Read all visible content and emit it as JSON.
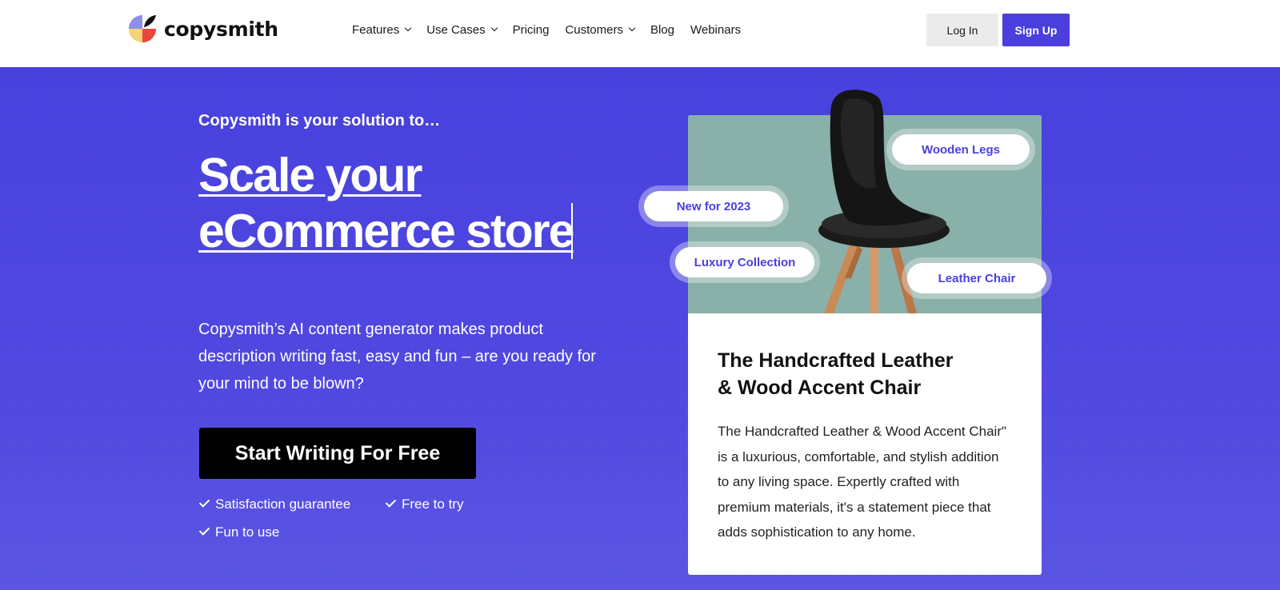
{
  "brand": {
    "name": "copysmith",
    "colors": {
      "primary": "#4a3fdc",
      "hero_bg": "#4b45df",
      "card_image_bg": "#8ab0aa"
    }
  },
  "nav": {
    "items": [
      {
        "label": "Features",
        "has_dropdown": true
      },
      {
        "label": "Use Cases",
        "has_dropdown": true
      },
      {
        "label": "Pricing",
        "has_dropdown": false
      },
      {
        "label": "Customers",
        "has_dropdown": true
      },
      {
        "label": "Blog",
        "has_dropdown": false
      },
      {
        "label": "Webinars",
        "has_dropdown": false
      }
    ],
    "login_label": "Log In",
    "signup_label": "Sign Up"
  },
  "hero": {
    "intro": "Copysmith is your solution to…",
    "headline_line1": "Scale your",
    "headline_line2": "eCommerce store",
    "description": "Copysmith’s AI content generator makes product description writing fast, easy and fun – are you ready for your mind to be blown?",
    "cta_label": "Start Writing For Free",
    "checks": [
      "Satisfaction guarantee",
      "Free to try",
      "Fun to use"
    ]
  },
  "product_card": {
    "tags": [
      "Wooden Legs",
      "New for 2023",
      "Luxury Collection",
      "Leather Chair"
    ],
    "title_line1": "The Handcrafted Leather",
    "title_line2": "& Wood Accent Chair",
    "body": "The Handcrafted Leather & Wood Accent Chair\" is a luxurious, comfortable, and stylish addition to any living space. Expertly crafted with premium materials, it's a statement piece that adds sophistication to any home."
  }
}
